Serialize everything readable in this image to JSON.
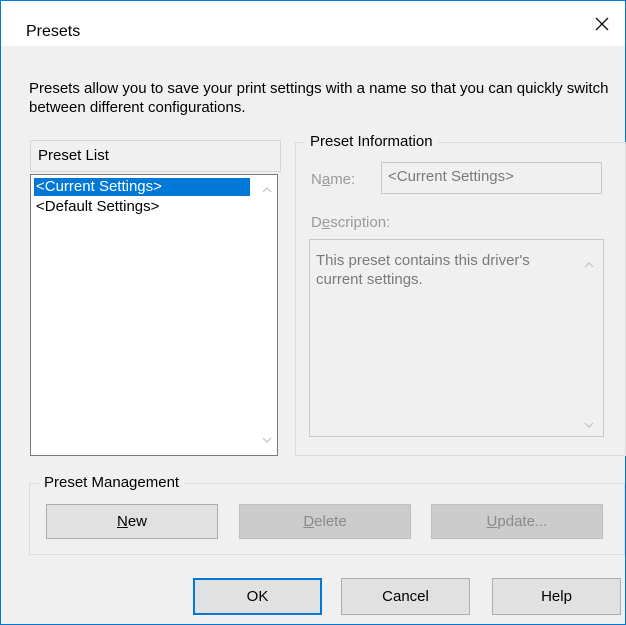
{
  "dialog": {
    "title": "Presets",
    "close_icon": "close-icon",
    "intro": "Presets allow you to save your print settings with a name so that you can quickly switch between different configurations."
  },
  "preset_list": {
    "label": "Preset List",
    "items": [
      {
        "label": "<Current Settings>",
        "selected": true
      },
      {
        "label": "<Default Settings>",
        "selected": false
      }
    ]
  },
  "preset_info": {
    "label": "Preset Information",
    "name_label_pre": "N",
    "name_label_ul": "a",
    "name_label_post": "me:",
    "name_value": "<Current Settings>",
    "description_label_pre": "D",
    "description_label_ul": "e",
    "description_label_post": "scription:",
    "description_value": "This preset contains this driver's current settings."
  },
  "preset_management": {
    "label": "Preset Management",
    "new_ul": "N",
    "new_rest": "ew",
    "delete_ul": "D",
    "delete_rest": "elete",
    "update_ul": "U",
    "update_rest": "pdate..."
  },
  "footer": {
    "ok": "OK",
    "cancel": "Cancel",
    "help": "Help"
  }
}
